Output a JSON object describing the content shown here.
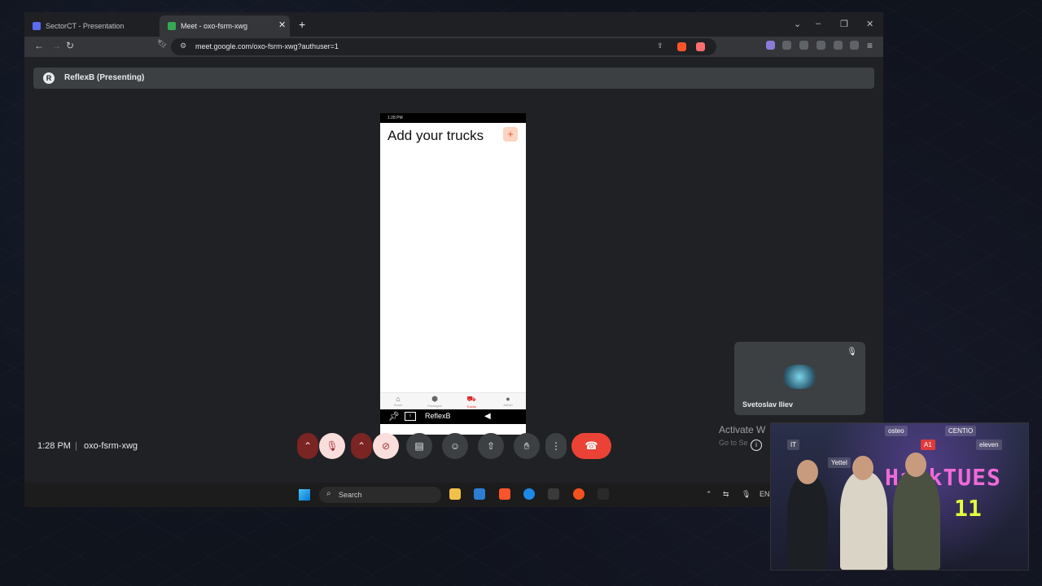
{
  "browser": {
    "tabs": [
      {
        "title": "SectorCT - Presentation",
        "active": false
      },
      {
        "title": "Meet - oxo-fsrm-xwg",
        "active": true
      }
    ],
    "url": "meet.google.com/oxo-fsrm-xwg?authuser=1"
  },
  "meet": {
    "presenting_label": "ReflexB (Presenting)",
    "time": "1:28 PM",
    "separator": "|",
    "meeting_code": "oxo-fsrm-xwg",
    "participant": {
      "name": "Svetoslav Iliev"
    },
    "activate_line1": "Activate W",
    "activate_line2": "Go to Se"
  },
  "phone": {
    "status_time": "1:28 PM",
    "title": "Add your trucks",
    "add_symbol": "+",
    "nav": [
      {
        "label": "Home",
        "icon": "home-icon",
        "active": false
      },
      {
        "label": "Packages",
        "icon": "packages-icon",
        "active": false
      },
      {
        "label": "Trucks",
        "icon": "truck-icon",
        "active": true
      },
      {
        "label": "Admin",
        "icon": "person-icon",
        "active": false
      }
    ],
    "present_name": "ReflexB"
  },
  "taskbar": {
    "search_placeholder": "Search",
    "lang": "ENG"
  },
  "webcam": {
    "sponsors": [
      "osteo",
      "CENTIO",
      "A1",
      "eleven",
      "Yettel",
      "IT"
    ],
    "event_title": "HackTUES",
    "event_number": "11"
  },
  "colors": {
    "accent_red": "#ea4335",
    "truck_active": "#e0292a",
    "add_button_bg": "#fbd4c2"
  }
}
